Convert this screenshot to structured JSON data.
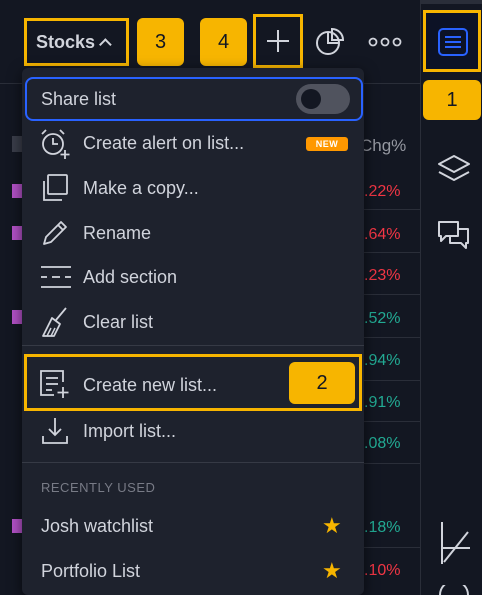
{
  "toolbar": {
    "watchlist_name": "Stocks",
    "badge_3": "3",
    "badge_4": "4"
  },
  "right_panel": {
    "badge_1": "1"
  },
  "menu": {
    "share_list": "Share list",
    "share_enabled": false,
    "create_alert": "Create alert on list...",
    "new_badge": "NEW",
    "make_copy": "Make a copy...",
    "rename": "Rename",
    "add_section": "Add section",
    "clear_list": "Clear list",
    "create_new_list": "Create new list...",
    "badge_2": "2",
    "import_list": "Import list...",
    "recently_used_label": "RECENTLY USED",
    "recent": [
      {
        "name": "Josh watchlist",
        "starred": true
      },
      {
        "name": "Portfolio List",
        "starred": true
      }
    ]
  },
  "background_table": {
    "column_header": "Chg%",
    "values": [
      ".22%",
      ".64%",
      ".23%",
      ".52%",
      ".94%",
      ".91%",
      ".08%",
      ".18%",
      ".10%"
    ],
    "colors": {
      "negative": "#f23645",
      "positive": "#22ab94"
    }
  },
  "colors": {
    "background": "#131722",
    "menu_background": "#1e222d",
    "highlight": "#f7b500",
    "accent_blue": "#2962ff"
  }
}
